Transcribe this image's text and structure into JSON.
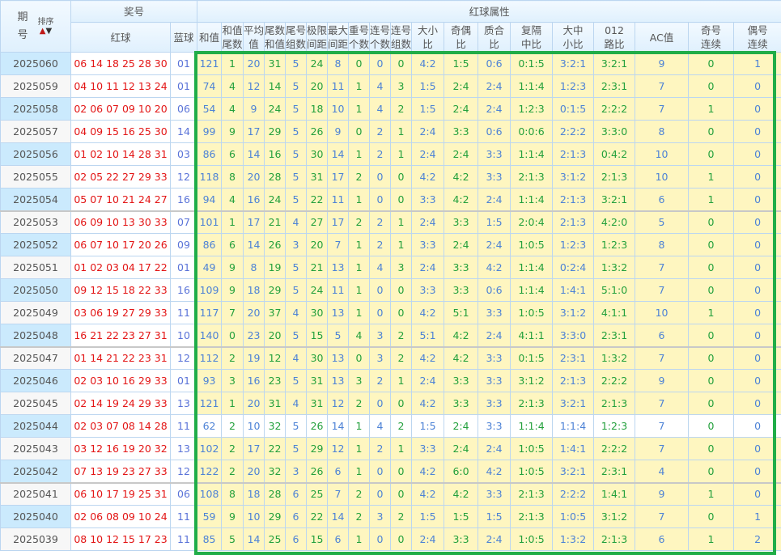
{
  "header": {
    "period_label_1": "期",
    "period_label_2": "号",
    "sort_label": "排序",
    "sort_up_icon": "▲",
    "sort_down_icon": "▼",
    "prize_group": "奖号",
    "red_label": "红球",
    "blue_label": "蓝球",
    "attr_group": "红球属性",
    "attr_columns": [
      [
        "和值",
        ""
      ],
      [
        "和值",
        "尾数"
      ],
      [
        "平均",
        "值"
      ],
      [
        "尾数",
        "和值"
      ],
      [
        "尾号",
        "组数"
      ],
      [
        "极限",
        "间距"
      ],
      [
        "最大",
        "间距"
      ],
      [
        "重号",
        "个数"
      ],
      [
        "连号",
        "个数"
      ],
      [
        "连号",
        "组数"
      ],
      [
        "大小",
        "比"
      ],
      [
        "奇偶",
        "比"
      ],
      [
        "质合",
        "比"
      ],
      [
        "复隔",
        "中比"
      ],
      [
        "大中",
        "小比"
      ],
      [
        "012",
        "路比"
      ],
      [
        "AC值",
        ""
      ],
      [
        "奇号",
        "连续"
      ],
      [
        "偶号",
        "连续"
      ]
    ]
  },
  "colors": {
    "highlight_border": "#20ad48",
    "red_ball": "#e31515",
    "blue_ball": "#5a73d8"
  },
  "rows": [
    {
      "period": "2025060",
      "red": "06 14 18 25 28 30",
      "blue": "01",
      "attrs": [
        "121",
        "1",
        "20",
        "31",
        "5",
        "24",
        "8",
        "0",
        "0",
        "0",
        "4:2",
        "1:5",
        "0:6",
        "0:1:5",
        "3:2:1",
        "3:2:1",
        "9",
        "0",
        "1"
      ]
    },
    {
      "period": "2025059",
      "red": "04 10 11 12 13 24",
      "blue": "01",
      "attrs": [
        "74",
        "4",
        "12",
        "14",
        "5",
        "20",
        "11",
        "1",
        "4",
        "3",
        "1:5",
        "2:4",
        "2:4",
        "1:1:4",
        "1:2:3",
        "2:3:1",
        "7",
        "0",
        "0"
      ]
    },
    {
      "period": "2025058",
      "red": "02 06 07 09 10 20",
      "blue": "06",
      "attrs": [
        "54",
        "4",
        "9",
        "24",
        "5",
        "18",
        "10",
        "1",
        "4",
        "2",
        "1:5",
        "2:4",
        "2:4",
        "1:2:3",
        "0:1:5",
        "2:2:2",
        "7",
        "1",
        "0"
      ]
    },
    {
      "period": "2025057",
      "red": "04 09 15 16 25 30",
      "blue": "14",
      "attrs": [
        "99",
        "9",
        "17",
        "29",
        "5",
        "26",
        "9",
        "0",
        "2",
        "1",
        "2:4",
        "3:3",
        "0:6",
        "0:0:6",
        "2:2:2",
        "3:3:0",
        "8",
        "0",
        "0"
      ]
    },
    {
      "period": "2025056",
      "red": "01 02 10 14 28 31",
      "blue": "03",
      "attrs": [
        "86",
        "6",
        "14",
        "16",
        "5",
        "30",
        "14",
        "1",
        "2",
        "1",
        "2:4",
        "2:4",
        "3:3",
        "1:1:4",
        "2:1:3",
        "0:4:2",
        "10",
        "0",
        "0"
      ]
    },
    {
      "period": "2025055",
      "red": "02 05 22 27 29 33",
      "blue": "12",
      "attrs": [
        "118",
        "8",
        "20",
        "28",
        "5",
        "31",
        "17",
        "2",
        "0",
        "0",
        "4:2",
        "4:2",
        "3:3",
        "2:1:3",
        "3:1:2",
        "2:1:3",
        "10",
        "1",
        "0"
      ]
    },
    {
      "period": "2025054",
      "red": "05 07 10 21 24 27",
      "blue": "16",
      "attrs": [
        "94",
        "4",
        "16",
        "24",
        "5",
        "22",
        "11",
        "1",
        "0",
        "0",
        "3:3",
        "4:2",
        "2:4",
        "1:1:4",
        "2:1:3",
        "3:2:1",
        "6",
        "1",
        "0"
      ]
    },
    {
      "period": "2025053",
      "red": "06 09 10 13 30 33",
      "blue": "07",
      "attrs": [
        "101",
        "1",
        "17",
        "21",
        "4",
        "27",
        "17",
        "2",
        "2",
        "1",
        "2:4",
        "3:3",
        "1:5",
        "2:0:4",
        "2:1:3",
        "4:2:0",
        "5",
        "0",
        "0"
      ]
    },
    {
      "period": "2025052",
      "red": "06 07 10 17 20 26",
      "blue": "09",
      "attrs": [
        "86",
        "6",
        "14",
        "26",
        "3",
        "20",
        "7",
        "1",
        "2",
        "1",
        "3:3",
        "2:4",
        "2:4",
        "1:0:5",
        "1:2:3",
        "1:2:3",
        "8",
        "0",
        "0"
      ]
    },
    {
      "period": "2025051",
      "red": "01 02 03 04 17 22",
      "blue": "01",
      "attrs": [
        "49",
        "9",
        "8",
        "19",
        "5",
        "21",
        "13",
        "1",
        "4",
        "3",
        "2:4",
        "3:3",
        "4:2",
        "1:1:4",
        "0:2:4",
        "1:3:2",
        "7",
        "0",
        "0"
      ]
    },
    {
      "period": "2025050",
      "red": "09 12 15 18 22 33",
      "blue": "16",
      "attrs": [
        "109",
        "9",
        "18",
        "29",
        "5",
        "24",
        "11",
        "1",
        "0",
        "0",
        "3:3",
        "3:3",
        "0:6",
        "1:1:4",
        "1:4:1",
        "5:1:0",
        "7",
        "0",
        "0"
      ]
    },
    {
      "period": "2025049",
      "red": "03 06 19 27 29 33",
      "blue": "11",
      "attrs": [
        "117",
        "7",
        "20",
        "37",
        "4",
        "30",
        "13",
        "1",
        "0",
        "0",
        "4:2",
        "5:1",
        "3:3",
        "1:0:5",
        "3:1:2",
        "4:1:1",
        "10",
        "1",
        "0"
      ]
    },
    {
      "period": "2025048",
      "red": "16 21 22 23 27 31",
      "blue": "10",
      "attrs": [
        "140",
        "0",
        "23",
        "20",
        "5",
        "15",
        "5",
        "4",
        "3",
        "2",
        "5:1",
        "4:2",
        "2:4",
        "4:1:1",
        "3:3:0",
        "2:3:1",
        "6",
        "0",
        "0"
      ]
    },
    {
      "period": "2025047",
      "red": "01 14 21 22 23 31",
      "blue": "12",
      "attrs": [
        "112",
        "2",
        "19",
        "12",
        "4",
        "30",
        "13",
        "0",
        "3",
        "2",
        "4:2",
        "4:2",
        "3:3",
        "0:1:5",
        "2:3:1",
        "1:3:2",
        "7",
        "0",
        "0"
      ]
    },
    {
      "period": "2025046",
      "red": "02 03 10 16 29 33",
      "blue": "01",
      "attrs": [
        "93",
        "3",
        "16",
        "23",
        "5",
        "31",
        "13",
        "3",
        "2",
        "1",
        "2:4",
        "3:3",
        "3:3",
        "3:1:2",
        "2:1:3",
        "2:2:2",
        "9",
        "0",
        "0"
      ]
    },
    {
      "period": "2025045",
      "red": "02 14 19 24 29 33",
      "blue": "13",
      "attrs": [
        "121",
        "1",
        "20",
        "31",
        "4",
        "31",
        "12",
        "2",
        "0",
        "0",
        "4:2",
        "3:3",
        "3:3",
        "2:1:3",
        "3:2:1",
        "2:1:3",
        "7",
        "0",
        "0"
      ]
    },
    {
      "period": "2025044",
      "red": "02 03 07 08 14 28",
      "blue": "11",
      "attrs": [
        "62",
        "2",
        "10",
        "32",
        "5",
        "26",
        "14",
        "1",
        "4",
        "2",
        "1:5",
        "2:4",
        "3:3",
        "1:1:4",
        "1:1:4",
        "1:2:3",
        "7",
        "0",
        "0"
      ]
    },
    {
      "period": "2025043",
      "red": "03 12 16 19 20 32",
      "blue": "13",
      "attrs": [
        "102",
        "2",
        "17",
        "22",
        "5",
        "29",
        "12",
        "1",
        "2",
        "1",
        "3:3",
        "2:4",
        "2:4",
        "1:0:5",
        "1:4:1",
        "2:2:2",
        "7",
        "0",
        "0"
      ]
    },
    {
      "period": "2025042",
      "red": "07 13 19 23 27 33",
      "blue": "12",
      "attrs": [
        "122",
        "2",
        "20",
        "32",
        "3",
        "26",
        "6",
        "1",
        "0",
        "0",
        "4:2",
        "6:0",
        "4:2",
        "1:0:5",
        "3:2:1",
        "2:3:1",
        "4",
        "0",
        "0"
      ]
    },
    {
      "period": "2025041",
      "red": "06 10 17 19 25 31",
      "blue": "06",
      "attrs": [
        "108",
        "8",
        "18",
        "28",
        "6",
        "25",
        "7",
        "2",
        "0",
        "0",
        "4:2",
        "4:2",
        "3:3",
        "2:1:3",
        "2:2:2",
        "1:4:1",
        "9",
        "1",
        "0"
      ]
    },
    {
      "period": "2025040",
      "red": "02 06 08 09 10 24",
      "blue": "11",
      "attrs": [
        "59",
        "9",
        "10",
        "29",
        "6",
        "22",
        "14",
        "2",
        "3",
        "2",
        "1:5",
        "1:5",
        "1:5",
        "2:1:3",
        "1:0:5",
        "3:1:2",
        "7",
        "0",
        "1"
      ]
    },
    {
      "period": "2025039",
      "red": "08 10 12 15 17 23",
      "blue": "11",
      "attrs": [
        "85",
        "5",
        "14",
        "25",
        "6",
        "15",
        "6",
        "1",
        "0",
        "0",
        "2:4",
        "3:3",
        "2:4",
        "1:0:5",
        "1:3:2",
        "2:1:3",
        "6",
        "1",
        "2"
      ]
    }
  ]
}
